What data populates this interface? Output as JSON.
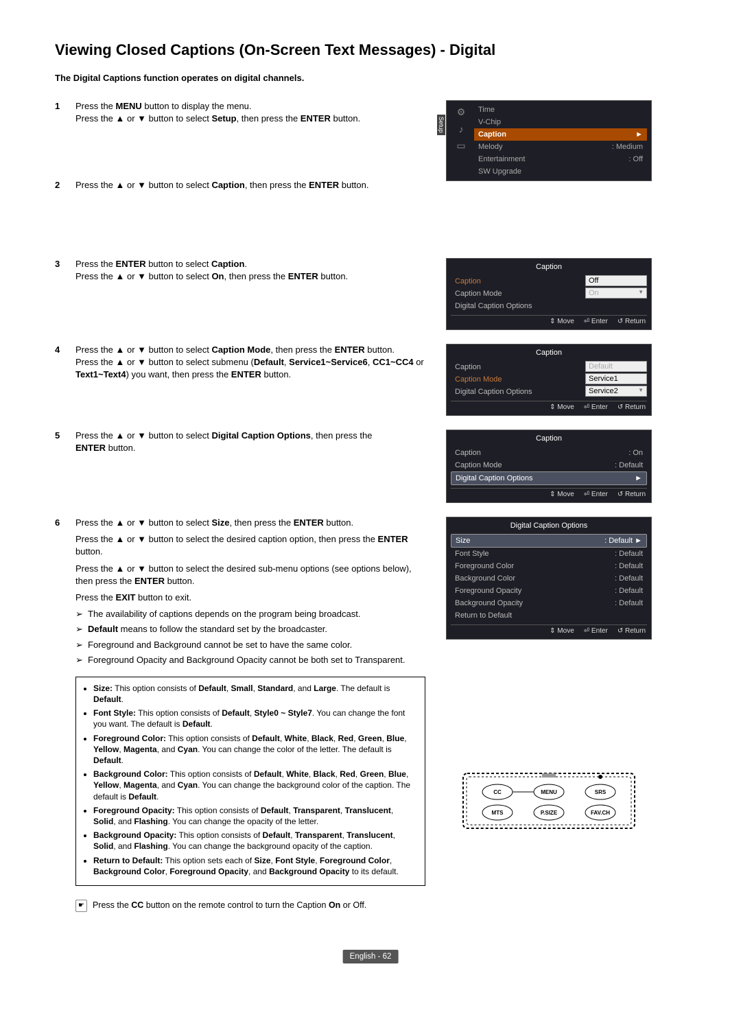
{
  "title": "Viewing Closed Captions (On-Screen Text Messages) - Digital",
  "subtitle": "The Digital Captions function operates on digital channels.",
  "steps": {
    "s1": {
      "num": "1",
      "l1a": "Press the ",
      "l1b": "MENU",
      "l1c": " button to display the menu.",
      "l2a": "Press the ▲ or ▼ button to select ",
      "l2b": "Setup",
      "l2c": ", then press the ",
      "l2d": "ENTER",
      "l2e": " button."
    },
    "s2": {
      "num": "2",
      "l1a": "Press the ▲ or ▼ button to select ",
      "l1b": "Caption",
      "l1c": ", then press the ",
      "l1d": "ENTER",
      "l1e": " button."
    },
    "s3": {
      "num": "3",
      "l1a": "Press the ",
      "l1b": "ENTER",
      "l1c": " button to select ",
      "l1d": "Caption",
      "l1e": ".",
      "l2a": "Press the ▲ or ▼ button to select ",
      "l2b": "On",
      "l2c": ", then press the ",
      "l2d": "ENTER",
      "l2e": " button."
    },
    "s4": {
      "num": "4",
      "l1a": "Press the ▲ or ▼ button to select ",
      "l1b": "Caption Mode",
      "l1c": ", then press the ",
      "l1d": "ENTER",
      "l1e": " button.",
      "l2a": "Press the ▲ or ▼ button to select submenu (",
      "l2b": "Default",
      "l2c": ", ",
      "l2d": "Service1~Service6",
      "l2e": ", ",
      "l3a": "CC1~CC4",
      "l3b": " or ",
      "l3c": "Text1~Text4",
      "l3d": ") you want, then press the ",
      "l3e": "ENTER",
      "l3f": " button."
    },
    "s5": {
      "num": "5",
      "l1a": "Press the ▲ or ▼ button to select ",
      "l1b": "Digital Caption Options",
      "l1c": ", then press the ",
      "l2a": "ENTER",
      "l2b": " button."
    },
    "s6": {
      "num": "6",
      "p1a": "Press the ▲ or ▼ button to select ",
      "p1b": "Size",
      "p1c": ", then press the ",
      "p1d": "ENTER",
      "p1e": " button.",
      "p2a": "Press the ▲ or ▼ button to select the desired caption option, then press the ",
      "p2b": "ENTER",
      "p2c": " button.",
      "p3a": "Press the ▲ or ▼ button to select the desired sub-menu options (see options below), then press the ",
      "p3b": "ENTER",
      "p3c": " button.",
      "p4a": "Press the ",
      "p4b": "EXIT",
      "p4c": " button to exit.",
      "a1": "The availability of captions depends on the program being broadcast.",
      "a2a": "Default",
      "a2b": " means to follow the standard set by the broadcaster.",
      "a3": "Foreground and Background cannot be set to have the same color.",
      "a4": "Foreground Opacity and Background Opacity cannot be both set to Transparent."
    }
  },
  "notes": {
    "n1a": "Size:",
    "n1b": " This option consists of ",
    "n1c": "Default",
    "n1d": ", ",
    "n1e": "Small",
    "n1f": ", ",
    "n1g": "Standard",
    "n1h": ", and ",
    "n1i": "Large",
    "n1j": ". The default is ",
    "n1k": "Default",
    "n1l": ".",
    "n2a": "Font Style:",
    "n2b": " This option consists of ",
    "n2c": "Default",
    "n2d": ", ",
    "n2e": "Style0 ~ Style7",
    "n2f": ". You can change the font you want. The default is ",
    "n2g": "Default",
    "n2h": ".",
    "n3a": "Foreground Color:",
    "n3b": " This option consists of ",
    "n3c": "Default",
    "n3d": ", ",
    "n3e": "White",
    "n3f": ", ",
    "n3g": "Black",
    "n3h": ", ",
    "n3i": "Red",
    "n3j": ", ",
    "n3k": "Green",
    "n3l": ", ",
    "n3m": "Blue",
    "n3n": ", ",
    "n3o": "Yellow",
    "n3p": ", ",
    "n3q": "Magenta",
    "n3r": ", and ",
    "n3s": "Cyan",
    "n3t": ". You can change the color of the letter. The default is ",
    "n3u": "Default",
    "n3v": ".",
    "n4a": "Background Color:",
    "n4b": " This option consists of ",
    "n4c": "Default",
    "n4d": ", ",
    "n4e": "White",
    "n4f": ", ",
    "n4g": "Black",
    "n4h": ", ",
    "n4i": "Red",
    "n4j": ", ",
    "n4k": "Green",
    "n4l": ", ",
    "n4m": "Blue",
    "n4n": ", ",
    "n4o": "Yellow",
    "n4p": ", ",
    "n4q": "Magenta",
    "n4r": ", and ",
    "n4s": "Cyan",
    "n4t": ". You can change the background color of the caption. The default is ",
    "n4u": "Default",
    "n4v": ".",
    "n5a": "Foreground Opacity:",
    "n5b": " This option consists of ",
    "n5c": "Default",
    "n5d": ", ",
    "n5e": "Transparent",
    "n5f": ", ",
    "n5g": "Translucent",
    "n5h": ", ",
    "n5i": "Solid",
    "n5j": ", and ",
    "n5k": "Flashing",
    "n5l": ". You can change the opacity of the letter.",
    "n6a": "Background Opacity:",
    "n6b": " This option consists of ",
    "n6c": "Default",
    "n6d": ", ",
    "n6e": "Transparent",
    "n6f": ", ",
    "n6g": "Translucent",
    "n6h": ", ",
    "n6i": "Solid",
    "n6j": ", and ",
    "n6k": "Flashing",
    "n6l": ". You can change the background opacity of the caption.",
    "n7a": "Return to Default:",
    "n7b": " This option sets each of ",
    "n7c": "Size",
    "n7d": ", ",
    "n7e": "Font Style",
    "n7f": ", ",
    "n7g": "Foreground Color",
    "n7h": ", ",
    "n7i": "Background Color",
    "n7j": ", ",
    "n7k": "Foreground Opacity",
    "n7l": ", and ",
    "n7m": "Background Opacity",
    "n7n": " to its default."
  },
  "remote_tip": {
    "a": "Press the ",
    "b": "CC",
    "c": " button on the remote control to turn the Caption ",
    "d": "On",
    "e": " or Off."
  },
  "footer": "English - 62",
  "menus": {
    "setup": {
      "vtab": "Setup",
      "items": {
        "time": "Time",
        "vchip": "V-Chip",
        "caption": "Caption",
        "melody_l": "Melody",
        "melody_v": ": Medium",
        "ent_l": "Entertainment",
        "ent_v": ": Off",
        "sw": "SW Upgrade"
      },
      "arrow": "►"
    },
    "m2": {
      "title": "Caption",
      "r1": "Caption",
      "r2": "Caption Mode",
      "r3": "Digital Caption Options",
      "dd1": "Off",
      "dd2": "On"
    },
    "m3": {
      "title": "Caption",
      "r1": "Caption",
      "r2": "Caption Mode",
      "r3": "Digital Caption Options",
      "dd1": "Default",
      "dd2": "Service1",
      "dd3": "Service2"
    },
    "m4": {
      "title": "Caption",
      "r1l": "Caption",
      "r1v": ": On",
      "r2l": "Caption Mode",
      "r2v": ": Default",
      "r3l": "Digital Caption Options",
      "arrow": "►"
    },
    "m5": {
      "title": "Digital Caption Options",
      "r1l": "Size",
      "r1v": ": Default",
      "arrow": "►",
      "r2l": "Font Style",
      "r2v": ": Default",
      "r3l": "Foreground Color",
      "r3v": ": Default",
      "r4l": "Background Color",
      "r4v": ": Default",
      "r5l": "Foreground Opacity",
      "r5v": ": Default",
      "r6l": "Background Opacity",
      "r6v": ": Default",
      "r7l": "Return to Default"
    },
    "footer": {
      "move": "⇕ Move",
      "enter": "⏎ Enter",
      "return": "↺ Return"
    }
  },
  "remote": {
    "cc": "CC",
    "menu": "MENU",
    "srs": "SRS",
    "mts": "MTS",
    "psize": "P.SIZE",
    "favch": "FAV.CH"
  }
}
